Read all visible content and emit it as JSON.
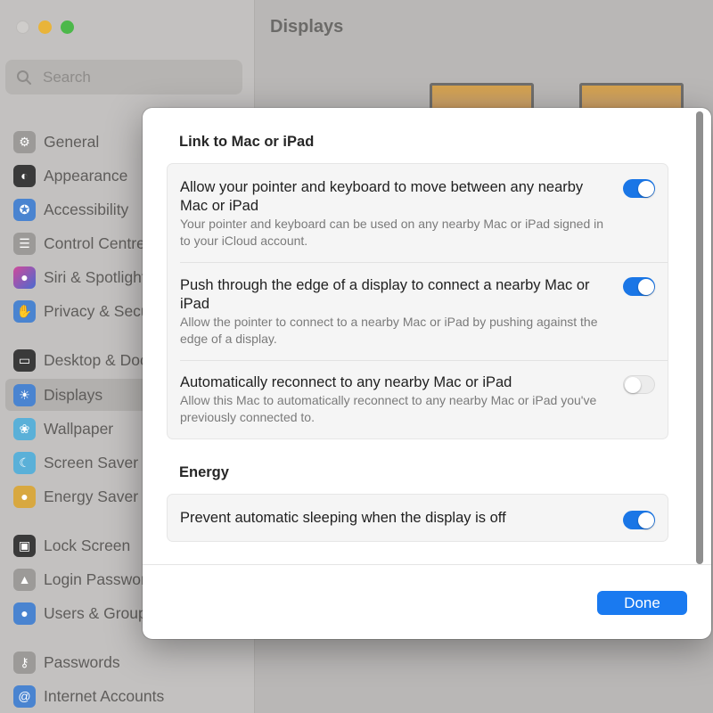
{
  "window": {
    "title": "Displays"
  },
  "search": {
    "placeholder": "Search"
  },
  "sidebar": {
    "items": [
      {
        "label": "General",
        "icon": "gear-icon",
        "color": "#9c9a98"
      },
      {
        "label": "Appearance",
        "icon": "appearance-icon",
        "color": "#3a3a3a"
      },
      {
        "label": "Accessibility",
        "icon": "accessibility-icon",
        "color": "#4a84d0"
      },
      {
        "label": "Control Centre",
        "icon": "control-centre-icon",
        "color": "#9c9a98"
      },
      {
        "label": "Siri & Spotlight",
        "icon": "siri-icon",
        "color": "#8a5fb0"
      },
      {
        "label": "Privacy & Security",
        "icon": "hand-icon",
        "color": "#4a84d0"
      },
      {
        "label": "Desktop & Dock",
        "icon": "dock-icon",
        "color": "#3a3a3a"
      },
      {
        "label": "Displays",
        "icon": "sun-icon",
        "color": "#4a84d0",
        "active": true
      },
      {
        "label": "Wallpaper",
        "icon": "wallpaper-icon",
        "color": "#5ab0d8"
      },
      {
        "label": "Screen Saver",
        "icon": "moon-icon",
        "color": "#5ab0d8"
      },
      {
        "label": "Energy Saver",
        "icon": "bulb-icon",
        "color": "#d8a840"
      },
      {
        "label": "Lock Screen",
        "icon": "lock-screen-icon",
        "color": "#3a3a3a"
      },
      {
        "label": "Login Password",
        "icon": "lock-icon",
        "color": "#9c9a98"
      },
      {
        "label": "Users & Groups",
        "icon": "users-icon",
        "color": "#4a84d0"
      },
      {
        "label": "Passwords",
        "icon": "key-icon",
        "color": "#9c9a98"
      },
      {
        "label": "Internet Accounts",
        "icon": "at-icon",
        "color": "#4a84d0"
      }
    ]
  },
  "sheet": {
    "link_section": {
      "heading": "Link to Mac or iPad",
      "rows": [
        {
          "title": "Allow your pointer and keyboard to move between any nearby Mac or iPad",
          "description": "Your pointer and keyboard can be used on any nearby Mac or iPad signed in to your iCloud account.",
          "enabled": true
        },
        {
          "title": "Push through the edge of a display to connect a nearby Mac or iPad",
          "description": "Allow the pointer to connect to a nearby Mac or iPad by pushing against the edge of a display.",
          "enabled": true
        },
        {
          "title": "Automatically reconnect to any nearby Mac or iPad",
          "description": "Allow this Mac to automatically reconnect to any nearby Mac or iPad you've previously connected to.",
          "enabled": false
        }
      ]
    },
    "energy_section": {
      "heading": "Energy",
      "rows": [
        {
          "title": "Prevent automatic sleeping when the display is off",
          "enabled": true
        }
      ]
    },
    "done_label": "Done"
  },
  "colors": {
    "accent": "#1a76e6",
    "toggle_off": "#ececec"
  }
}
